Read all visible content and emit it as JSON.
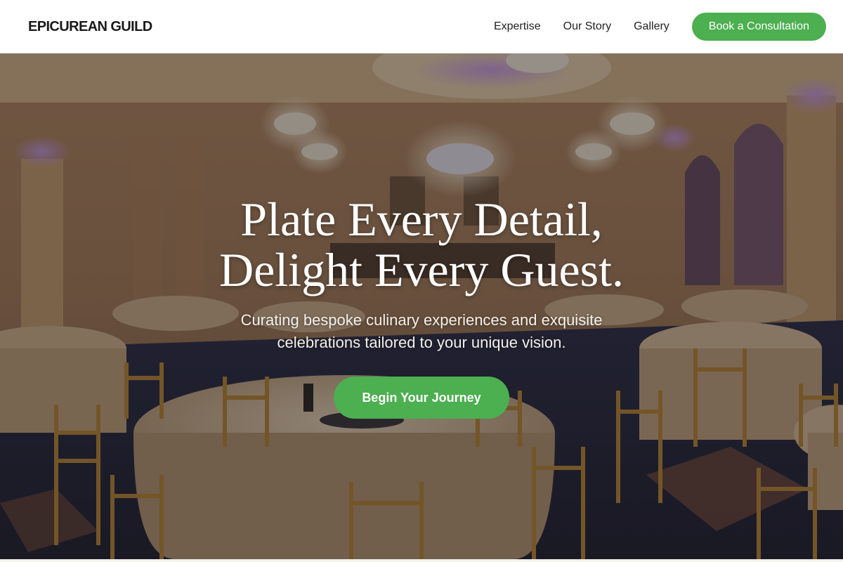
{
  "header": {
    "logo": "EPICUREAN GUILD",
    "nav": [
      "Expertise",
      "Our Story",
      "Gallery"
    ],
    "cta": "Book a Consultation"
  },
  "hero": {
    "title_line1": "Plate Every Detail,",
    "title_line2": "Delight Every Guest.",
    "subtitle": "Curating bespoke culinary experiences and exquisite celebrations tailored to your unique vision.",
    "button": "Begin Your Journey",
    "image": "banquet-hall-photo"
  },
  "colors": {
    "accent": "#4caf50",
    "header_bg": "#ffffff",
    "text_dark": "#1a1a1a"
  }
}
